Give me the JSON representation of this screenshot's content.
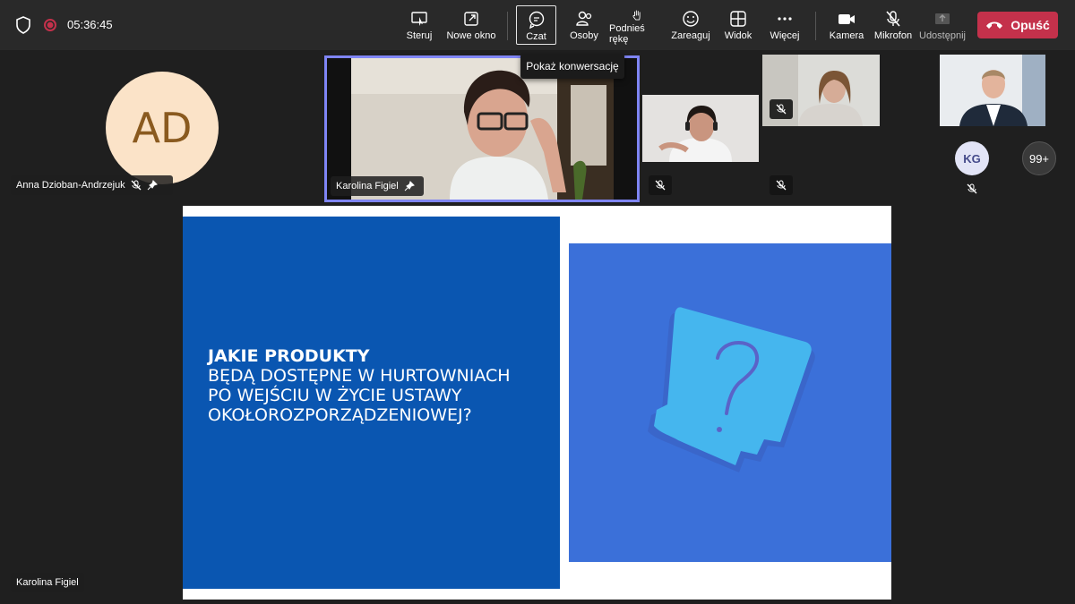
{
  "status": {
    "timer": "05:36:45"
  },
  "toolbar": {
    "steruj": "Steruj",
    "nowe_okno": "Nowe okno",
    "czat": "Czat",
    "osoby": "Osoby",
    "podnies_reke": "Podnieś rękę",
    "zareaguj": "Zareaguj",
    "widok": "Widok",
    "wiecej": "Więcej",
    "kamera": "Kamera",
    "mikrofon": "Mikrofon",
    "udostepnij": "Udostępnij",
    "leave": "Opuść"
  },
  "tooltip": "Pokaż konwersację",
  "participants": {
    "anna": {
      "initials": "AD",
      "name": "Anna Dzioban-Andrzejuk"
    },
    "karolina": {
      "name": "Karolina Figiel"
    },
    "kg": {
      "initials": "KG"
    },
    "more": "99+"
  },
  "presenter": {
    "name": "Karolina Figiel"
  },
  "slide": {
    "line1": "Jakie produkty",
    "line2": "będą dostępne w hurtowniach",
    "line3": "po wejściu w życie ustawy",
    "line4": "okołorozporządzeniowej?"
  },
  "colors": {
    "accent": "#7f85f5",
    "leave": "#c4314b",
    "slide_blue": "#0a56b1",
    "avatar_bg": "#fbe3c8"
  }
}
